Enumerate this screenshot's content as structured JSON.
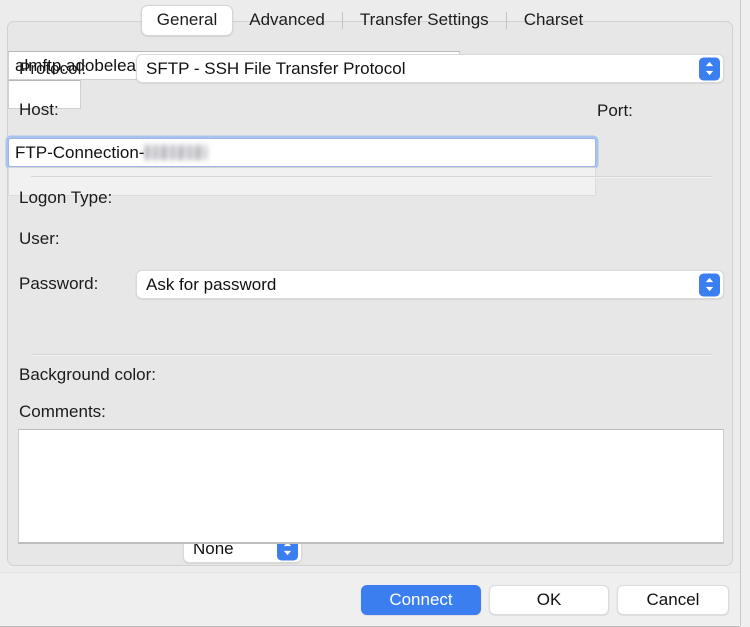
{
  "dialog": {
    "tabs": [
      {
        "label": "General",
        "selected": true
      },
      {
        "label": "Advanced",
        "selected": false
      },
      {
        "label": "Transfer Settings",
        "selected": false
      },
      {
        "label": "Charset",
        "selected": false
      }
    ],
    "fields": {
      "protocol": {
        "label": "Protocol:",
        "value": "SFTP - SSH File Transfer Protocol",
        "control": "popup-button"
      },
      "host": {
        "label": "Host:",
        "value": "almftp.adobelearningmanager.com",
        "placeholder": "",
        "control": "text-field"
      },
      "port": {
        "label": "Port:",
        "value": "",
        "placeholder": "",
        "control": "text-field"
      },
      "logon_type": {
        "label": "Logon Type:",
        "value": "Ask for password",
        "control": "popup-button"
      },
      "user": {
        "label": "User:",
        "value": "FTP-Connection-",
        "redacted_suffix": true,
        "focused": true,
        "control": "text-field"
      },
      "password": {
        "label": "Password:",
        "value": "",
        "disabled": true,
        "control": "text-field"
      },
      "background_color": {
        "label": "Background color:",
        "value": "None",
        "control": "popup-button"
      },
      "comments": {
        "label": "Comments:",
        "value": "",
        "control": "text-area"
      }
    },
    "buttons": [
      {
        "label": "Connect",
        "style": "primary"
      },
      {
        "label": "OK",
        "style": "default"
      },
      {
        "label": "Cancel",
        "style": "default"
      }
    ]
  },
  "colors": {
    "accent": "#3b7ef0",
    "focus_ring": "#a8c3ee",
    "window_bg": "#ececec",
    "panel_bg": "#e7e7e7"
  },
  "icons": {
    "stepper": "chevron-up-down-icon"
  }
}
